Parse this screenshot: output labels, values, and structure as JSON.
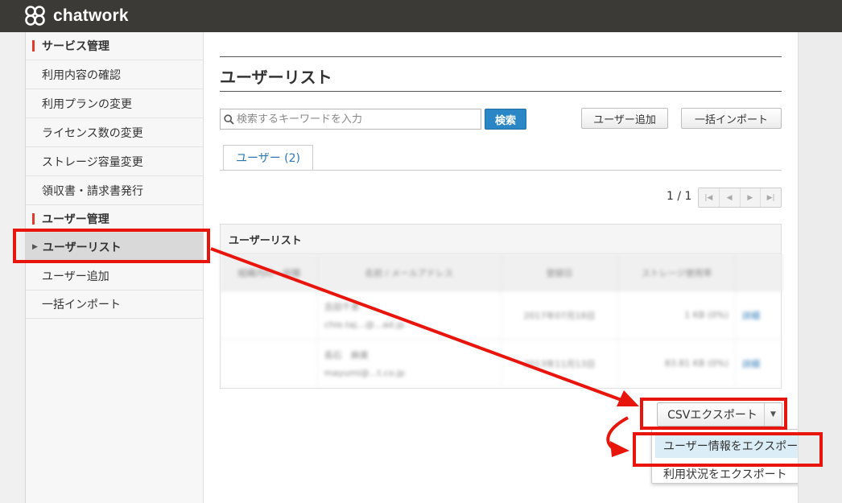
{
  "app": {
    "name": "chatwork"
  },
  "sidebar": {
    "sections": [
      {
        "title": "サービス管理",
        "items": [
          "利用内容の確認",
          "利用プランの変更",
          "ライセンス数の変更",
          "ストレージ容量変更",
          "領収書・請求書発行"
        ]
      },
      {
        "title": "ユーザー管理",
        "items": [
          "ユーザーリスト",
          "ユーザー追加",
          "一括インポート"
        ]
      }
    ]
  },
  "main": {
    "title": "ユーザーリスト",
    "search": {
      "placeholder": "検索するキーワードを入力",
      "button": "検索"
    },
    "actions": {
      "add_user": "ユーザー追加",
      "bulk_import": "一括インポート"
    },
    "tab": "ユーザー (2)",
    "pager": {
      "text": "1 / 1",
      "icons": [
        "first-page-icon",
        "prev-page-icon",
        "next-page-icon",
        "last-page-icon"
      ]
    },
    "card_title": "ユーザーリスト",
    "table": {
      "columns": [
        "組織内ID・役職",
        "名前 / メールアドレス",
        "登録日",
        "ストレージ使用率",
        ""
      ],
      "rows": [
        {
          "id": "",
          "name": "吉田千恵",
          "email": "chie.taj...@...ad.jp",
          "date": "2017年07月18日",
          "storage": "1 KB (0%)",
          "action": "詳細"
        },
        {
          "id": "",
          "name": "長石　麻美",
          "email": "mayumi@...t.co.jp",
          "date": "2013年11月13日",
          "storage": "83.81 KB (0%)",
          "action": "詳細"
        }
      ]
    },
    "export": {
      "button": "CSVエクスポート",
      "menu": [
        "ユーザー情報をエクスポート",
        "利用状況をエクスポート"
      ]
    }
  },
  "colors": {
    "accent_red": "#e8150c",
    "primary_blue": "#2b86c5",
    "topbar": "#3b3a36"
  }
}
